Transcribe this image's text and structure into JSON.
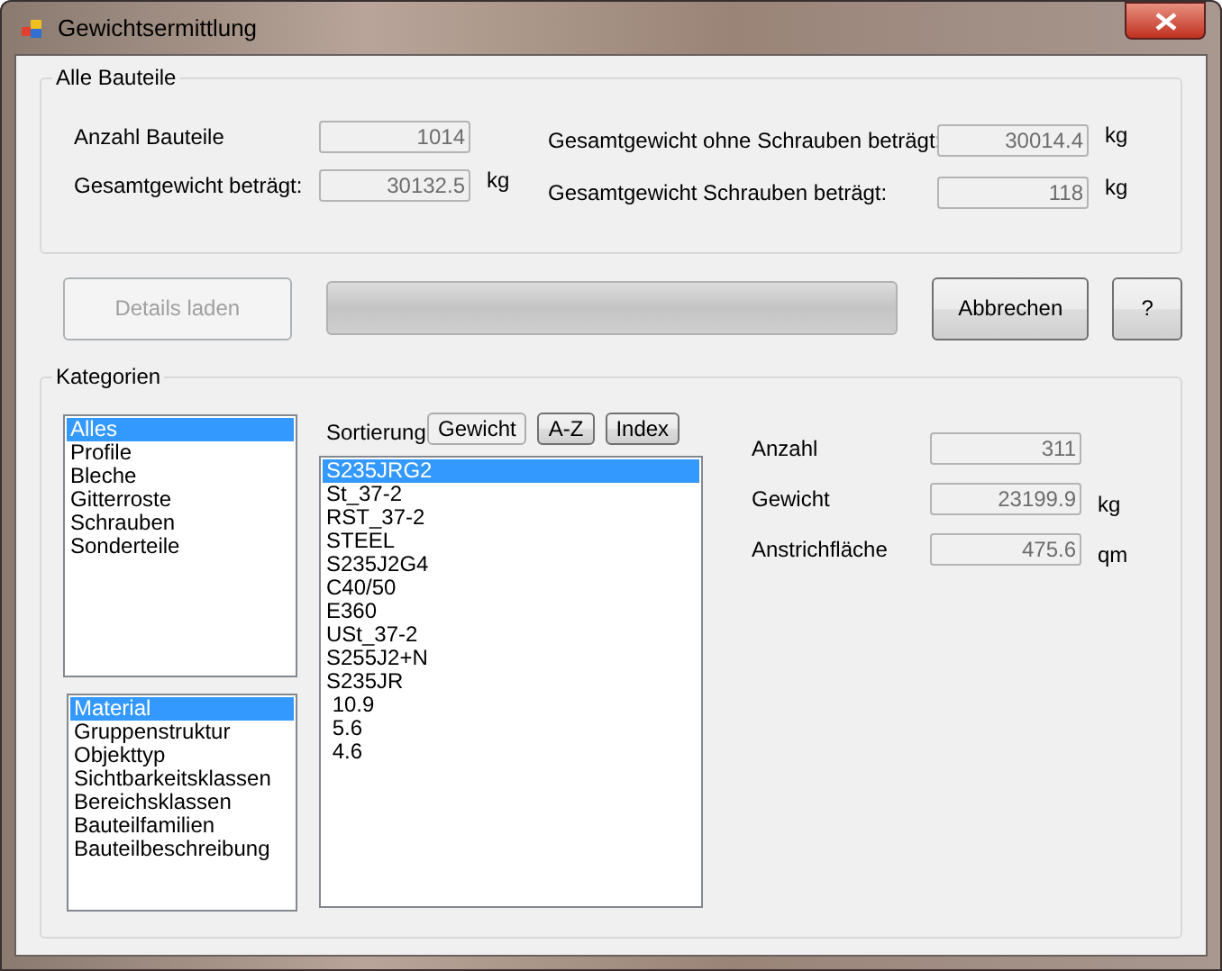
{
  "window": {
    "title": "Gewichtsermittlung"
  },
  "alle_bauteile": {
    "title": "Alle Bauteile",
    "left": [
      {
        "label": "Anzahl Bauteile",
        "value": "1014"
      },
      {
        "label": "Gesamtgewicht beträgt:",
        "value": "30132.5",
        "unit": "kg"
      }
    ],
    "right": [
      {
        "label": "Gesamtgewicht ohne Schrauben beträgt:",
        "value": "30014.4",
        "unit": "kg"
      },
      {
        "label": "Gesamtgewicht Schrauben beträgt:",
        "value": "118",
        "unit": "kg"
      }
    ]
  },
  "actions": {
    "details_button": {
      "label": "Details laden",
      "disabled": true
    },
    "progress": {
      "level": 0
    },
    "buttons": [
      {
        "label": "Abbrechen"
      },
      {
        "label": "?"
      }
    ]
  },
  "kategorien": {
    "title": "Kategorien",
    "categories": [
      {
        "label": "Alles",
        "selected": true
      },
      {
        "label": "Profile",
        "selected": false
      },
      {
        "label": "Bleche",
        "selected": false
      },
      {
        "label": "Gitterroste",
        "selected": false
      },
      {
        "label": "Schrauben",
        "selected": false
      },
      {
        "label": "Sonderteile",
        "selected": false
      }
    ],
    "groupings": [
      {
        "label": "Material",
        "selected": true
      },
      {
        "label": "Gruppenstruktur",
        "selected": false
      },
      {
        "label": "Objekttyp",
        "selected": false
      },
      {
        "label": "Sichtbarkeitsklassen",
        "selected": false
      },
      {
        "label": "Bereichsklassen",
        "selected": false
      },
      {
        "label": "Bauteilfamilien",
        "selected": false
      },
      {
        "label": "Bauteilbeschreibung",
        "selected": false
      }
    ],
    "sort_label": "Sortierung",
    "sort_buttons": [
      {
        "label": "Gewicht",
        "selected": true
      },
      {
        "label": "A-Z",
        "selected": false
      },
      {
        "label": "Index",
        "selected": false
      }
    ],
    "values": [
      {
        "label": "S235JRG2",
        "selected": true
      },
      {
        "label": "St_37-2",
        "selected": false
      },
      {
        "label": "RST_37-2",
        "selected": false
      },
      {
        "label": "STEEL",
        "selected": false
      },
      {
        "label": "S235J2G4",
        "selected": false
      },
      {
        "label": "C40/50",
        "selected": false
      },
      {
        "label": "E360",
        "selected": false
      },
      {
        "label": "USt_37-2",
        "selected": false
      },
      {
        "label": "S255J2+N",
        "selected": false
      },
      {
        "label": "S235JR",
        "selected": false
      },
      {
        "label": " 10.9",
        "selected": false
      },
      {
        "label": " 5.6",
        "selected": false
      },
      {
        "label": " 4.6",
        "selected": false
      }
    ],
    "stats": [
      {
        "label": "Anzahl",
        "value": "311"
      },
      {
        "label": "Gewicht",
        "value": "23199.9",
        "unit": "kg"
      },
      {
        "label": "Anstrichfläche",
        "value": "475.6",
        "unit": "qm"
      }
    ]
  }
}
